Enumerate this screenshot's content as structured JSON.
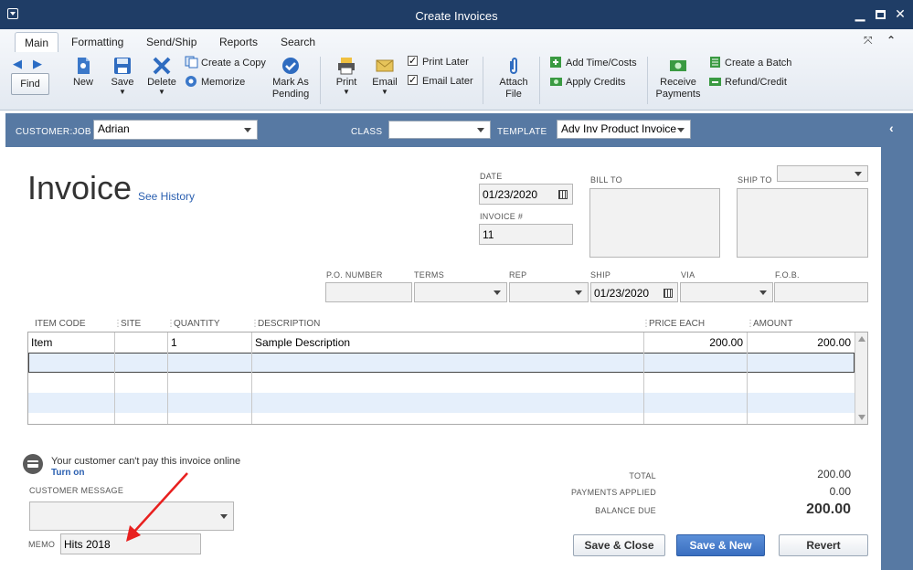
{
  "window": {
    "title": "Create Invoices"
  },
  "ribbon": {
    "tabs": [
      "Main",
      "Formatting",
      "Send/Ship",
      "Reports",
      "Search"
    ],
    "find_label": "Find",
    "new_label": "New",
    "save_label": "Save",
    "delete_label": "Delete",
    "create_copy_label": "Create a Copy",
    "memorize_label": "Memorize",
    "mark_pending_label_1": "Mark As",
    "mark_pending_label_2": "Pending",
    "print_label": "Print",
    "email_label": "Email",
    "print_later_label": "Print Later",
    "email_later_label": "Email Later",
    "attach_label_1": "Attach",
    "attach_label_2": "File",
    "add_time_label": "Add Time/Costs",
    "apply_credits_label": "Apply Credits",
    "receive_payments_label_1": "Receive",
    "receive_payments_label_2": "Payments",
    "create_batch_label": "Create a Batch",
    "refund_credit_label": "Refund/Credit"
  },
  "customer_bar": {
    "customer_job_label": "CUSTOMER:JOB",
    "customer_job_value": "Adrian",
    "class_label": "CLASS",
    "class_value": "",
    "template_label": "TEMPLATE",
    "template_value": "Adv Inv Product Invoice"
  },
  "form": {
    "heading": "Invoice",
    "see_history": "See History",
    "date_label": "DATE",
    "date_value": "01/23/2020",
    "invoice_no_label": "INVOICE #",
    "invoice_no_value": "11",
    "bill_to_label": "BILL TO",
    "ship_to_label": "SHIP TO",
    "po_number_label": "P.O. NUMBER",
    "terms_label": "TERMS",
    "rep_label": "REP",
    "ship_label": "SHIP",
    "ship_value": "01/23/2020",
    "via_label": "VIA",
    "fob_label": "F.O.B."
  },
  "grid": {
    "columns": [
      "ITEM CODE",
      "SITE",
      "QUANTITY",
      "DESCRIPTION",
      "PRICE EACH",
      "AMOUNT"
    ],
    "rows": [
      {
        "item": "Item",
        "site": "",
        "quantity": "1",
        "description": "Sample Description",
        "price": "200.00",
        "amount": "200.00"
      }
    ]
  },
  "footer": {
    "online_msg": "Your customer can't pay this invoice online",
    "turn_on": "Turn on",
    "customer_message_label": "CUSTOMER MESSAGE",
    "memo_label": "MEMO",
    "memo_value": "Hits 2018",
    "total_label": "TOTAL",
    "total_value": "200.00",
    "payments_applied_label": "PAYMENTS APPLIED",
    "payments_applied_value": "0.00",
    "balance_due_label": "BALANCE DUE",
    "balance_due_value": "200.00",
    "save_close": "Save & Close",
    "save_new": "Save & New",
    "revert": "Revert"
  },
  "colors": {
    "title_bar": "#1f3d66",
    "customer_bar": "#5779a3",
    "annotation_arrow": "#e8201f",
    "primary_button": "#3a6fc0"
  }
}
